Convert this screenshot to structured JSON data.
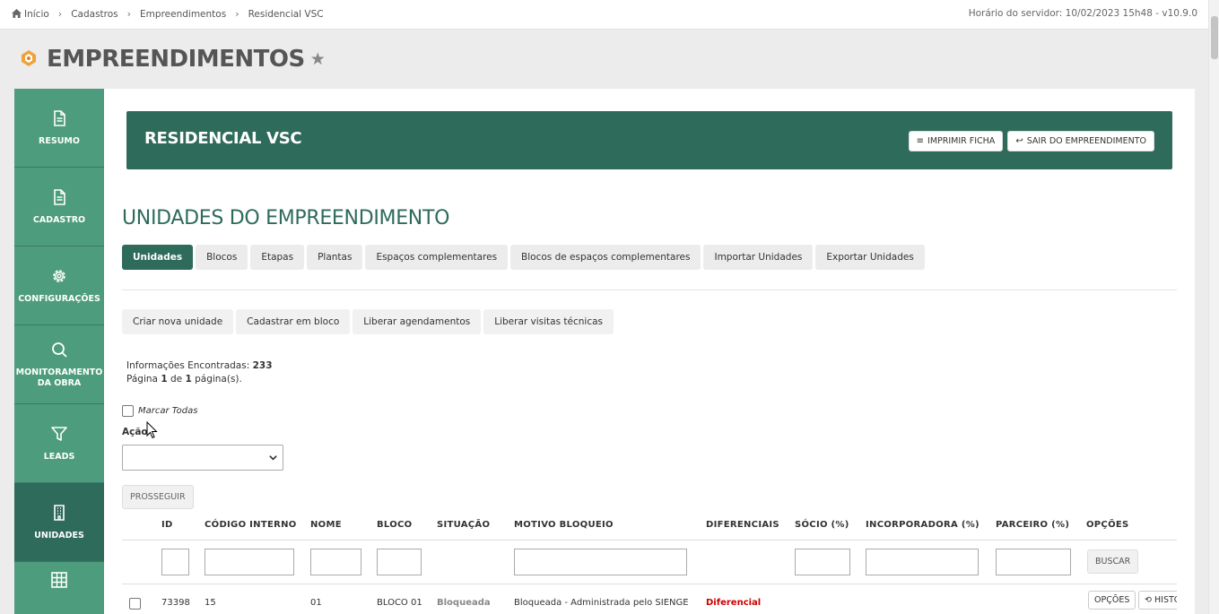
{
  "breadcrumb": [
    "Início",
    "Cadastros",
    "Empreendimentos",
    "Residencial VSC"
  ],
  "server_time": "Horário do servidor: 10/02/2023 15h48 - v10.9.0",
  "page_title": "EMPREENDIMENTOS",
  "sidebar": {
    "items": [
      {
        "label": "RESUMO",
        "icon": "document-icon",
        "active": false
      },
      {
        "label": "CADASTRO",
        "icon": "document-icon",
        "active": false
      },
      {
        "label": "CONFIGURAÇÕES",
        "icon": "gear-icon",
        "active": false
      },
      {
        "label": "MONITORAMENTO DA OBRA",
        "icon": "search-icon",
        "active": false
      },
      {
        "label": "LEADS",
        "icon": "funnel-icon",
        "active": false
      },
      {
        "label": "UNIDADES",
        "icon": "building-icon",
        "active": true
      },
      {
        "label": "",
        "icon": "grid-icon",
        "active": false
      }
    ]
  },
  "banner": {
    "title": "RESIDENCIAL VSC",
    "print_label": "IMPRIMIR FICHA",
    "exit_label": "SAIR DO EMPREENDIMENTO"
  },
  "section_title": "UNIDADES DO EMPREENDIMENTO",
  "tabs": [
    "Unidades",
    "Blocos",
    "Etapas",
    "Plantas",
    "Espaços complementares",
    "Blocos de espaços complementares",
    "Importar Unidades",
    "Exportar Unidades"
  ],
  "active_tab": "Unidades",
  "actions": [
    "Criar nova unidade",
    "Cadastrar em bloco",
    "Liberar agendamentos",
    "Liberar visitas técnicas"
  ],
  "info": {
    "found_label": "Informações Encontradas:",
    "found_count": "233",
    "page_prefix": "Página",
    "page_current": "1",
    "page_of": "de",
    "page_total": "1",
    "page_suffix": "página(s)."
  },
  "mark_all_label": "Marcar Todas",
  "action_label": "Ação",
  "action_select_value": "",
  "proceed_label": "PROSSEGUIR",
  "table": {
    "columns": [
      "ID",
      "CÓDIGO INTERNO",
      "NOME",
      "BLOCO",
      "SITUAÇÃO",
      "MOTIVO BLOQUEIO",
      "DIFERENCIAIS",
      "SÓCIO (%)",
      "INCORPORADORA (%)",
      "PARCEIRO (%)",
      "OPÇÕES"
    ],
    "search_label": "BUSCAR",
    "rows": [
      {
        "id": "73398",
        "codigo": "15",
        "nome": "01",
        "bloco": "BLOCO 01",
        "situacao": "Bloqueada",
        "motivo": "Bloqueada - Administrada pelo SIENGE",
        "diferenciais": "Diferencial",
        "opcoes_label": "OPÇÕES",
        "historico_label": "HISTÓ"
      }
    ]
  },
  "colors": {
    "primary": "#2e6b5a",
    "sidebar_item": "#4d9c7d",
    "accent_red": "#cc0000"
  }
}
